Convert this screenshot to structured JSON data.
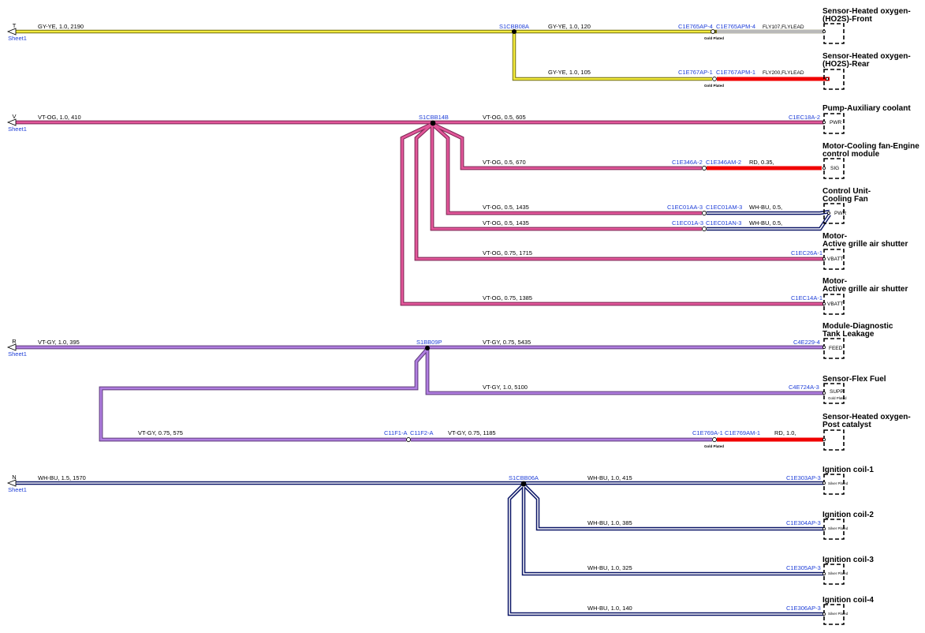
{
  "colors": {
    "yellow": "#f2ea3c",
    "pink": "#e2579a",
    "violet": "#b07ee0",
    "navy": "#0a1566",
    "gray": "#b9b9b9",
    "red": "#f00000",
    "blue": "#1f3fd8"
  },
  "offsheet": {
    "sheet_label": "Sheet1",
    "circuits": [
      "T",
      "V",
      "R",
      "N"
    ]
  },
  "circuits": {
    "T": {
      "wire_in": "GY-YE,  1.0,  2190",
      "splice": "S1CBB08A",
      "br1": "GY-YE,  1.0,  120",
      "br1_c1": "C1E765AP-4",
      "br1_c2": "C1E765APM-4",
      "br1_tail": "FLY107,FLYLEAD",
      "br1_plating": "Gold Plated",
      "br2": "GY-YE,  1.0,  105",
      "br2_c1": "C1E767AP-1",
      "br2_c2": "C1E767APM-1",
      "br2_tail": "FLY200,FLYLEAD",
      "br2_plating": "Gold Plated"
    },
    "V": {
      "wire_in": "VT-OG,  1.0,  410",
      "splice": "S1CBB14B",
      "w1": "VT-OG,  0.5,  605",
      "c1": "C1EC18A-2",
      "w2": "VT-OG,  0.5,  670",
      "c2a": "C1E346A-2",
      "c2b": "C1E346AM-2",
      "w2r": "RD,  0.35,",
      "w3": "VT-OG,  0.5,  1435",
      "c3a": "C1EC01AA-3",
      "c3b": "C1EC01AM-3",
      "w3r": "WH-BU,  0.5,",
      "w4": "VT-OG,  0.5,  1435",
      "c4a": "C1EC01A-3",
      "c4b": "C1EC01AN-3",
      "w4r": "WH-BU,  0.5,",
      "w5": "VT-OG,  0.75,  1715",
      "c5": "C1EC26A-1",
      "w6": "VT-OG,  0.75,  1385",
      "c6": "C1EC14A-1"
    },
    "R": {
      "wire_in": "VT-GY,  1.0,  395",
      "splice": "S1BB09P",
      "w1": "VT-GY,  0.75,  5435",
      "c1": "C4E229-4",
      "w2": "VT-GY,  1.0,  5100",
      "c2": "C4E724A-3",
      "w3a": "VT-GY,  0.75,  575",
      "c3a": "C11F1-A",
      "c3b": "C11F2-A",
      "w3b": "VT-GY,  0.75,  1185",
      "c3c": "C1E769A-1",
      "c3d": "C1E769AM-1",
      "w3r": "RD,  1.0,",
      "c3_plating": "Gold Plated"
    },
    "N": {
      "wire_in": "WH-BU,  1.5,  1570",
      "splice": "S1CBB06A",
      "w1": "WH-BU,  1.0,  415",
      "c1": "C1E303AP-3",
      "w2": "WH-BU,  1.0,  385",
      "c2": "C1E304AP-3",
      "w3": "WH-BU,  1.0,  325",
      "c3": "C1E305AP-3",
      "w4": "WH-BU,  1.0,  140",
      "c4": "C1E306AP-3"
    }
  },
  "components": [
    {
      "name_l1": "Sensor-Heated oxygen-",
      "name_l2": "(HO2S)-Front",
      "pin": ""
    },
    {
      "name_l1": "Sensor-Heated oxygen-",
      "name_l2": "(HO2S)-Rear",
      "pin": ""
    },
    {
      "name_l1": "Pump-Auxiliary coolant",
      "name_l2": "",
      "pin": "PWR"
    },
    {
      "name_l1": "Motor-Cooling fan-Engine",
      "name_l2": "control module",
      "pin": "SIG"
    },
    {
      "name_l1": "Control Unit-",
      "name_l2": "Cooling Fan",
      "pin": "PWR"
    },
    {
      "name_l1": "Motor-",
      "name_l2": "Active grille air shutter",
      "pin": "VBATT"
    },
    {
      "name_l1": "Motor-",
      "name_l2": "Active grille air shutter",
      "pin": "VBATT"
    },
    {
      "name_l1": "Module-Diagnostic",
      "name_l2": "Tank Leakage",
      "pin": "FEED"
    },
    {
      "name_l1": "Sensor-Flex Fuel",
      "name_l2": "",
      "pin": "SUPP",
      "plating": "Gold Plated"
    },
    {
      "name_l1": "Sensor-Heated oxygen-",
      "name_l2": "Post catalyst",
      "pin": ""
    },
    {
      "name_l1": "Ignition coil-1",
      "name_l2": "",
      "pin": "",
      "plating": "Silver Plated"
    },
    {
      "name_l1": "Ignition coil-2",
      "name_l2": "",
      "pin": "",
      "plating": "Silver Plated"
    },
    {
      "name_l1": "Ignition coil-3",
      "name_l2": "",
      "pin": "",
      "plating": "Silver Plated"
    },
    {
      "name_l1": "Ignition coil-4",
      "name_l2": "",
      "pin": "",
      "plating": "Silver Plated"
    }
  ]
}
